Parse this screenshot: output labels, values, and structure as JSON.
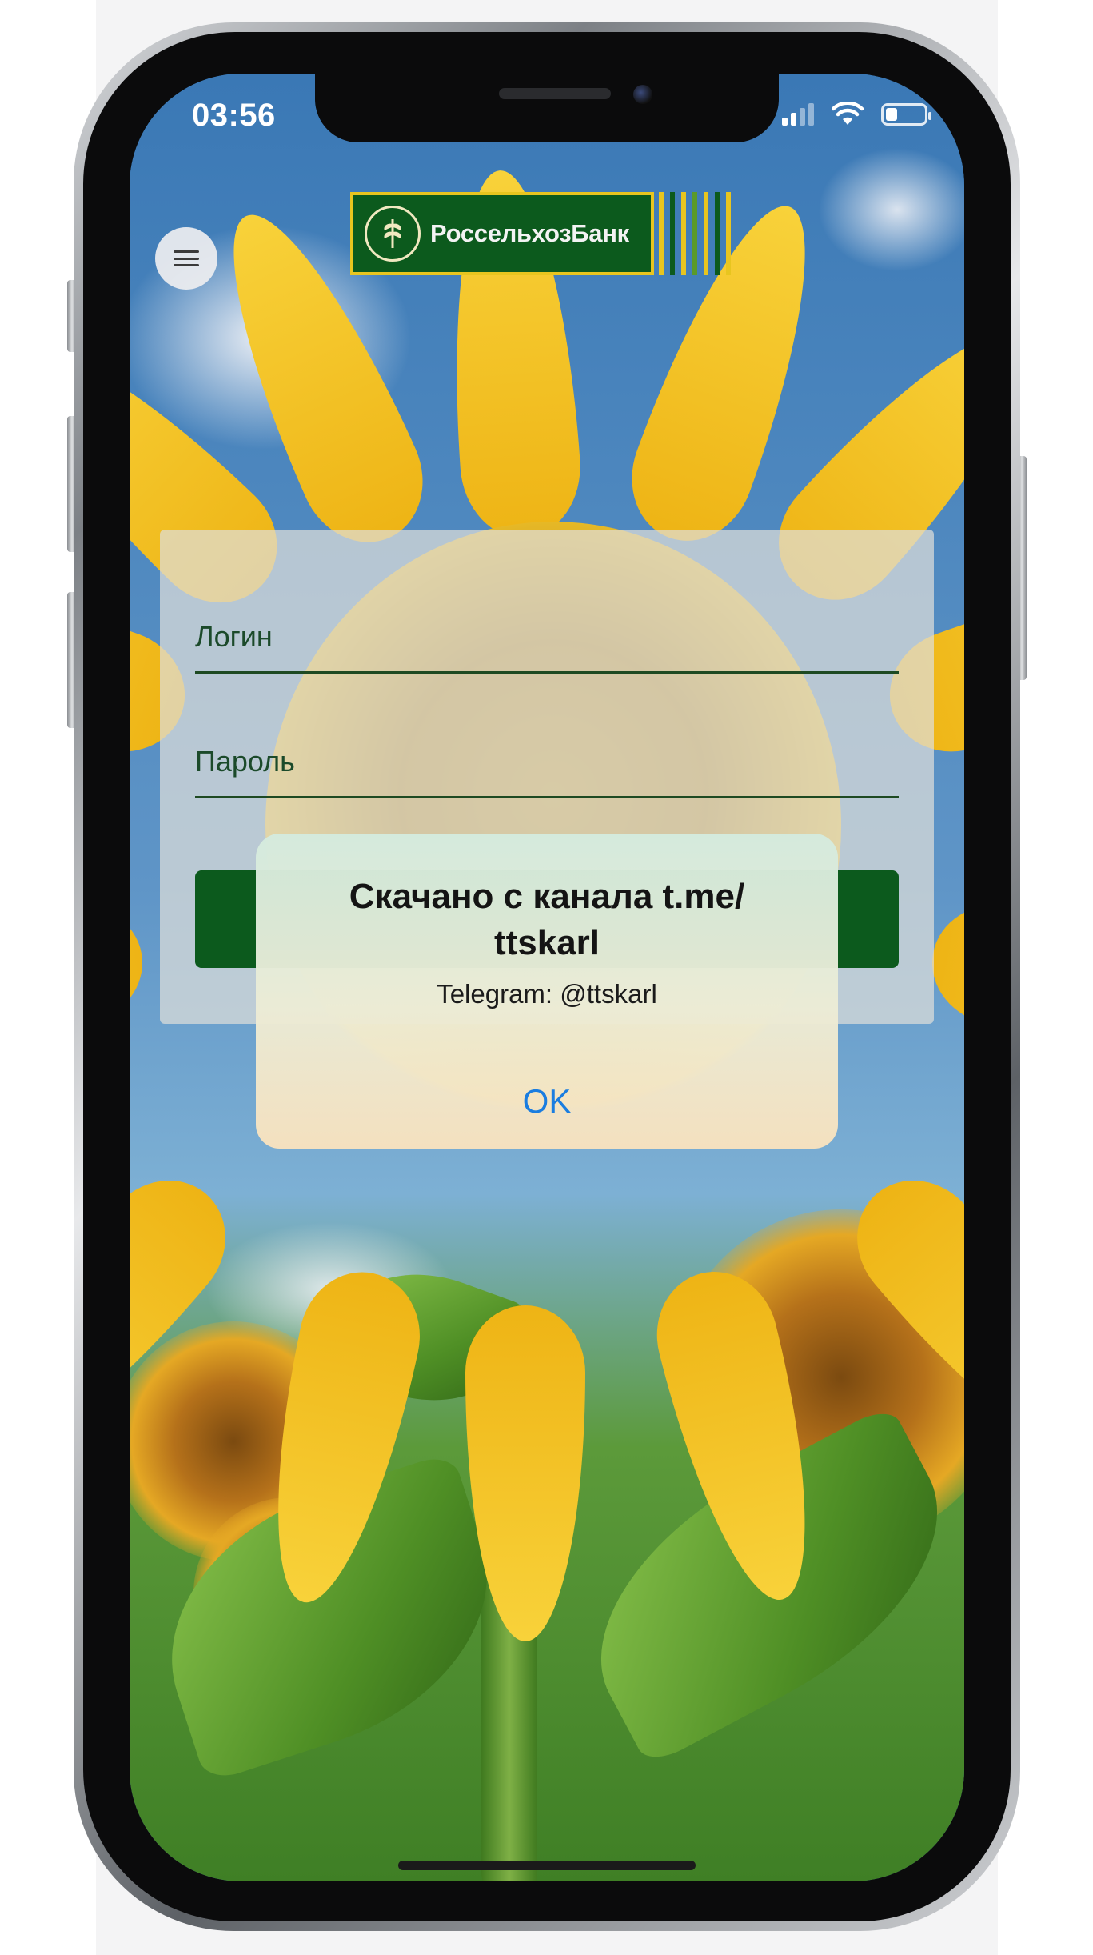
{
  "status_bar": {
    "time": "03:56",
    "battery_level": 0.3,
    "icons": [
      "cellular-signal-icon",
      "wifi-icon",
      "battery-icon"
    ]
  },
  "header": {
    "menu_icon": "hamburger-menu-icon",
    "logo_text": "РоссельхозБанк",
    "logo_emblem": "bank-emblem-logo",
    "colors": {
      "brand_green": "#0c5a1d",
      "brand_yellow": "#e8c51f"
    }
  },
  "login_form": {
    "login_label": "Логин",
    "password_label": "Пароль",
    "submit_button_color": "#0c5a1d"
  },
  "alert": {
    "title": "Скачано с канала t.me/ ttskarl",
    "message": "Telegram: @ttskarl",
    "ok_label": "OK",
    "ok_color": "#1a7de0"
  }
}
